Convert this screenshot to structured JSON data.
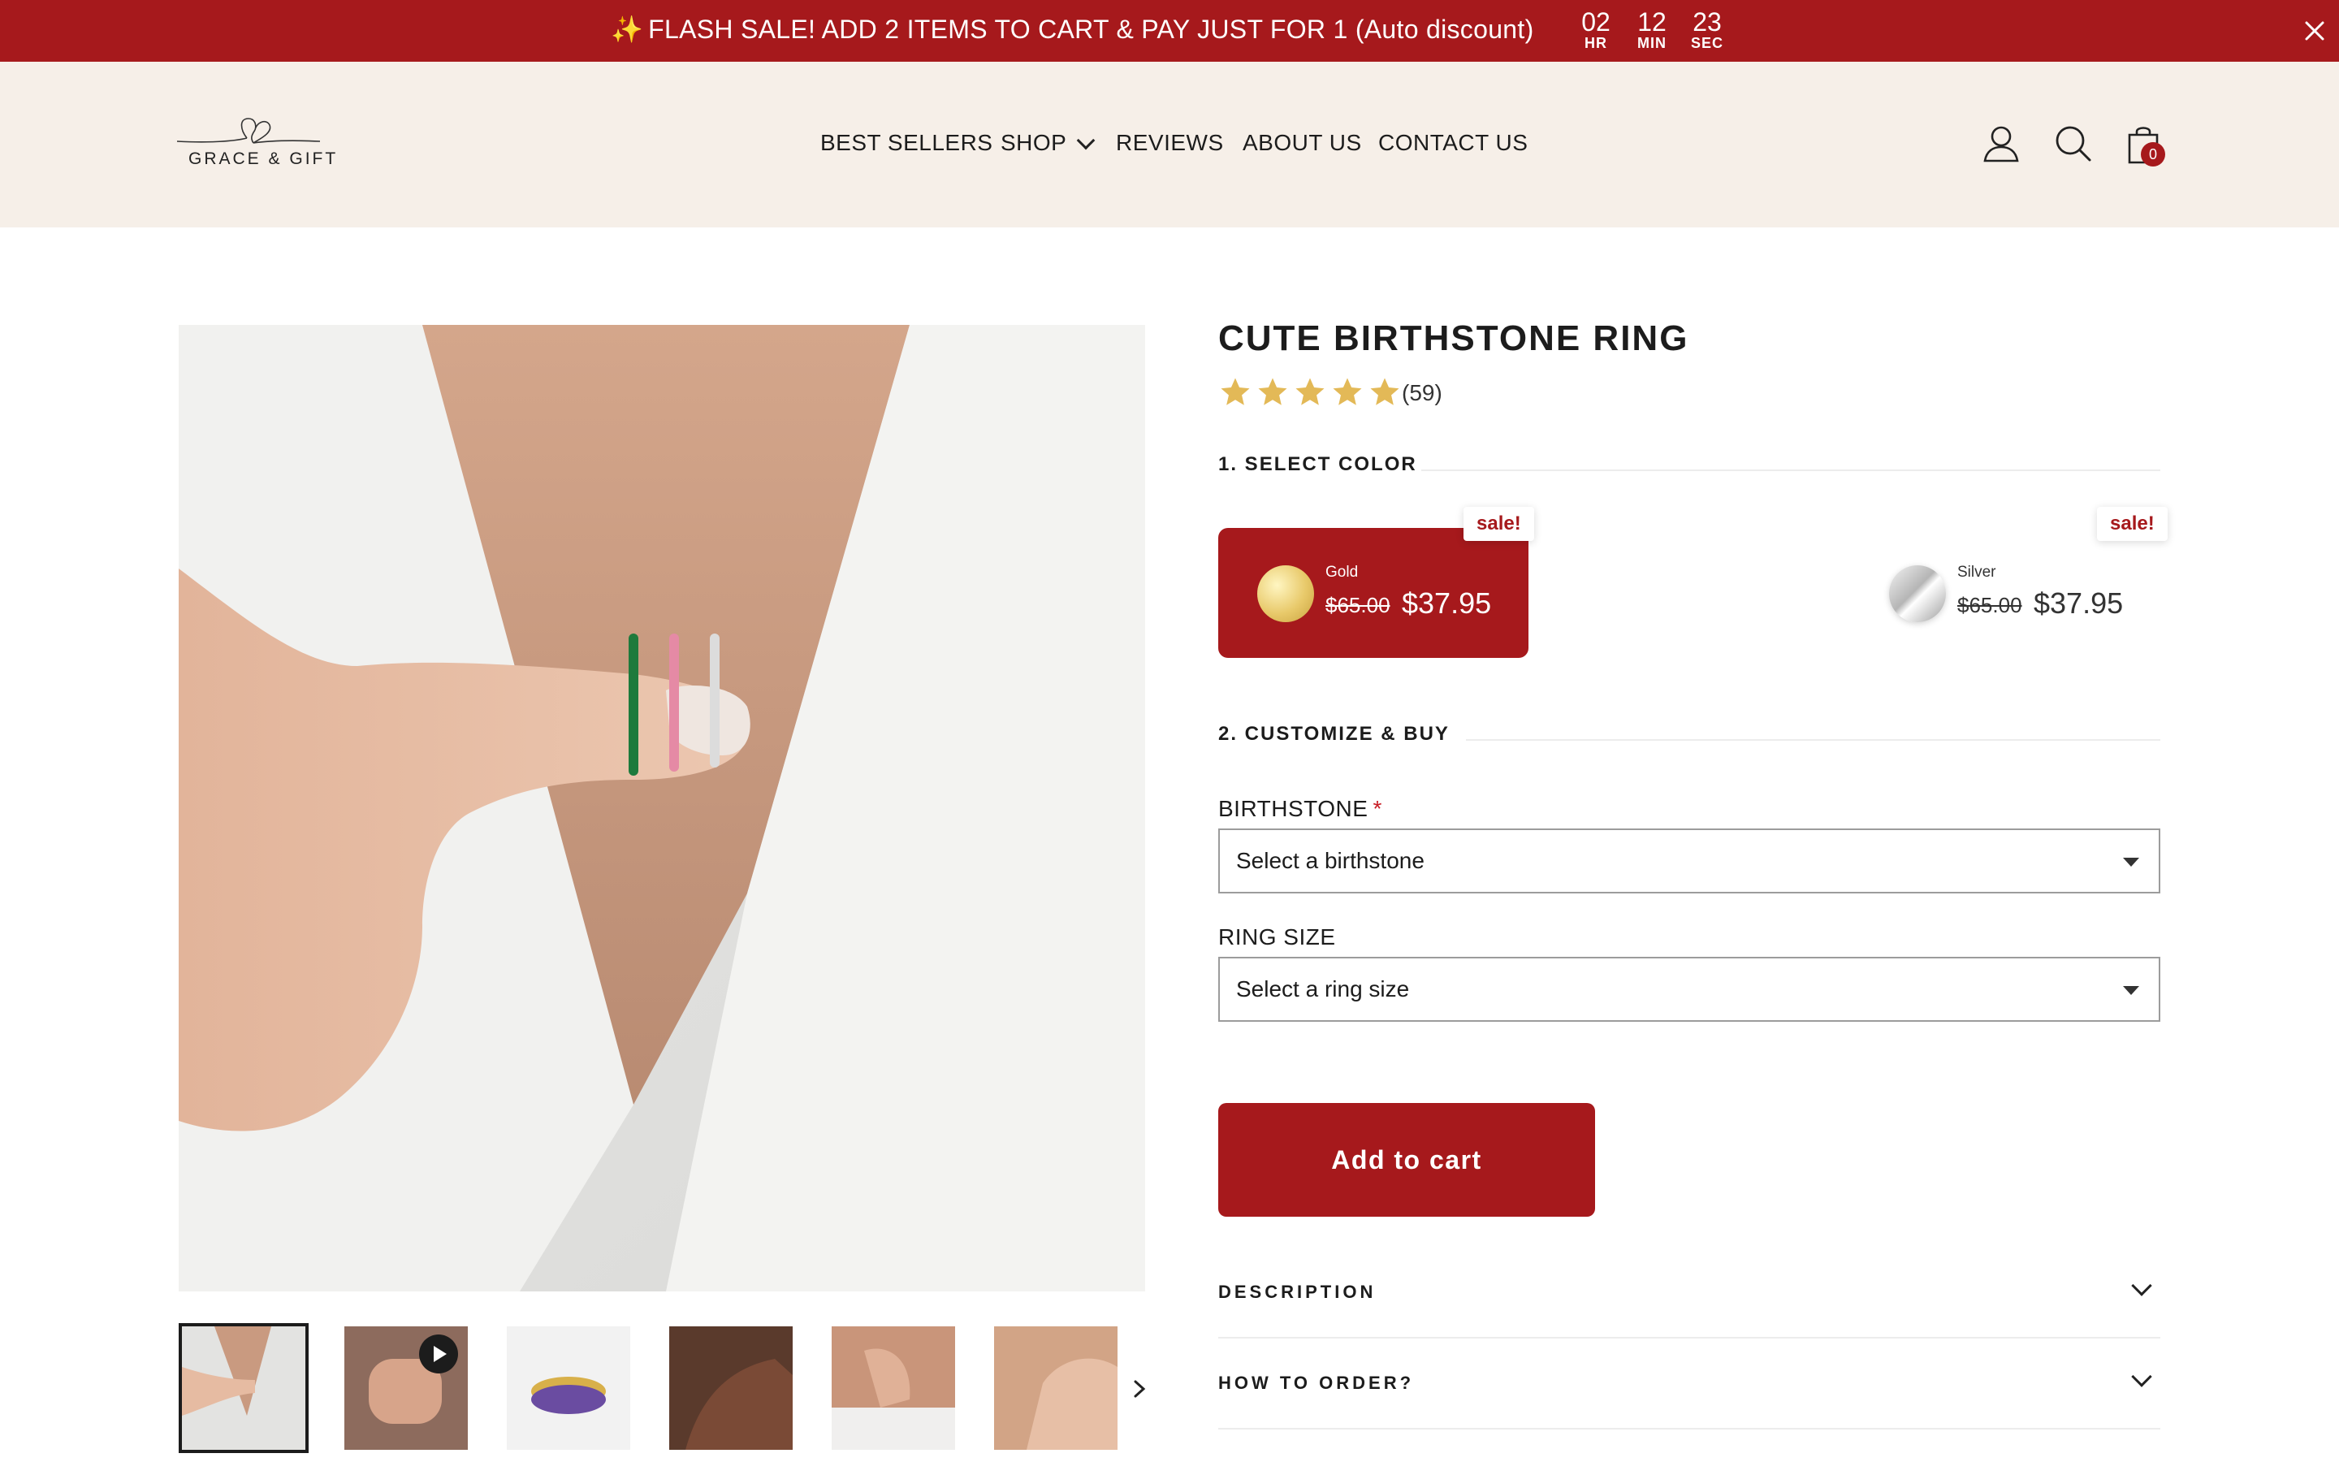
{
  "announcement": {
    "sparkle": "✨",
    "message": "FLASH SALE! ADD 2 ITEMS TO CART & PAY JUST FOR 1 (Auto discount)",
    "timer": [
      {
        "value": "02",
        "unit": "HR"
      },
      {
        "value": "12",
        "unit": "MIN"
      },
      {
        "value": "23",
        "unit": "SEC"
      }
    ],
    "close_icon": "close-icon"
  },
  "header": {
    "logo_text": "GRACE & GIFT",
    "nav": [
      {
        "label": "BEST SELLERS"
      },
      {
        "label": "SHOP",
        "has_dropdown": true
      },
      {
        "label": "REVIEWS"
      },
      {
        "label": "ABOUT US"
      },
      {
        "label": "CONTACT US"
      }
    ],
    "icons": [
      "user-icon",
      "search-icon",
      "cart-icon"
    ],
    "cart_count": "0"
  },
  "product": {
    "title": "CUTE BIRTHSTONE RING",
    "rating": 5,
    "review_count": "(59)",
    "steps": {
      "color": "1. SELECT COLOR",
      "customize": "2. CUSTOMIZE & BUY"
    },
    "colors": [
      {
        "name": "Gold",
        "old_price": "$65.00",
        "price": "$37.95",
        "badge": "sale!",
        "selected": true
      },
      {
        "name": "Silver",
        "old_price": "$65.00",
        "price": "$37.95",
        "badge": "sale!",
        "selected": false
      }
    ],
    "birthstone": {
      "label": "BIRTHSTONE",
      "required_mark": "*",
      "placeholder": "Select a birthstone"
    },
    "ring_size": {
      "label": "RING SIZE",
      "placeholder": "Select a ring size"
    },
    "add_to_cart": "Add to cart",
    "accordions": [
      "DESCRIPTION",
      "HOW TO ORDER?"
    ],
    "thumbnail_count": 6,
    "video_thumbnail_index": 1
  },
  "colors": {
    "brand_red": "#a6191c",
    "header_bg": "#f6efe8",
    "star": "#e3b957"
  }
}
